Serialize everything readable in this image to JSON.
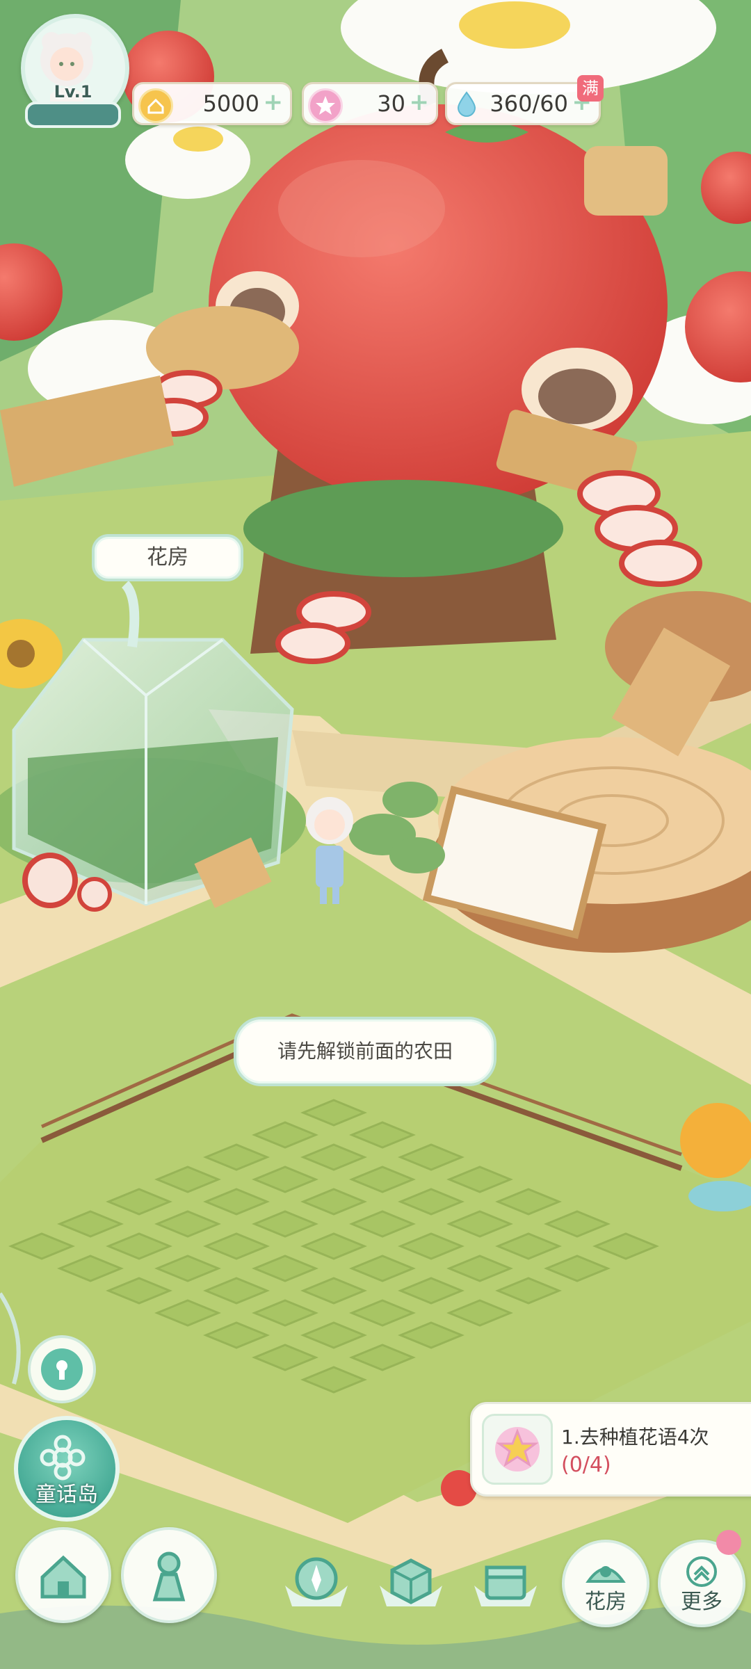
{
  "hud": {
    "level": "Lv.1",
    "coins": "5000",
    "stars": "30",
    "water": "360/60",
    "water_full_badge": "满"
  },
  "labels": {
    "greenhouse": "花房",
    "farm_hint": "请先解锁前面的农田"
  },
  "quest": {
    "title": "1.去种植花语4次",
    "progress": "(0/4)"
  },
  "nav": {
    "fairy_island": "童话岛",
    "flower_house": "花房",
    "more": "更多"
  },
  "icons": {
    "coin": "house-coin-icon",
    "star": "pink-star-icon",
    "water": "water-drop-icon",
    "home": "home-icon",
    "wardrobe": "dress-icon",
    "compass": "compass-icon",
    "box": "storage-box-icon",
    "gift": "gift-box-icon",
    "keyhole": "keyhole-icon",
    "flower_house": "flower-house-icon",
    "more": "chevron-up-icon"
  },
  "colors": {
    "grass": "#b8d27a",
    "path": "#f1dfb3",
    "apple_red": "#e44b45",
    "teal_accent": "#3aa58e",
    "progress_red": "#d34e5e"
  }
}
